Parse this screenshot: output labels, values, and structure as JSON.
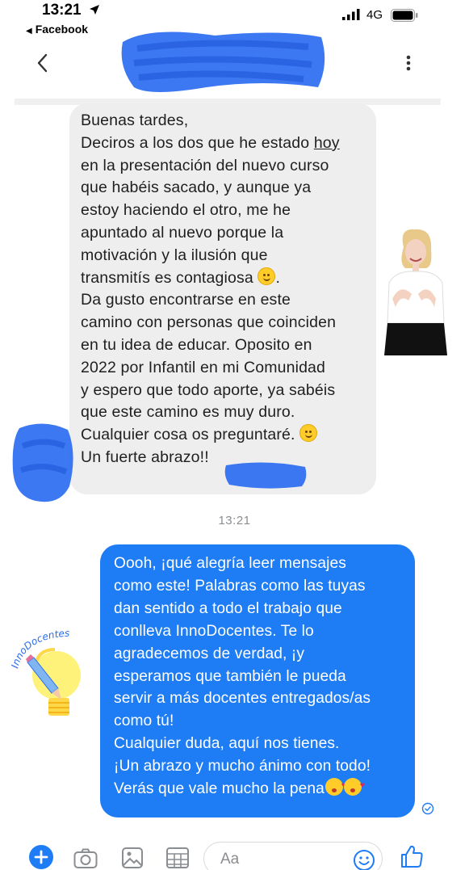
{
  "status_bar": {
    "time": "13:21",
    "back_app": "Facebook",
    "network": "4G"
  },
  "header": {
    "contact_name_redacted": true
  },
  "messages": {
    "received": {
      "lines_1": [
        "Buenas tardes,",
        "Deciros a los dos que he estado "
      ],
      "underlined_word": "hoy",
      "lines_2": "en la presentación del nuevo curso\nque habéis sacado, y aunque ya\nestoy haciendo el otro, me he\napuntado al nuevo porque la\nmotivación y la ilusión que",
      "line_contagiosa": "transmitís es contagiosa ",
      "dot": ".",
      "lines_3": "Da gusto encontrarse en este\ncamino con personas que coinciden\nen tu idea de educar. Oposito en\n2022  por Infantil en mi Comunidad\ny espero que todo aporte, ya sabéis\nque este camino es muy duro.",
      "line_pregunto": "Cualquier cosa os preguntaré. ",
      "line_abrazo": "Un fuerte abrazo!!"
    },
    "timestamp": "13:21",
    "sent": {
      "lines": [
        "Oooh, ¡qué alegría leer mensajes",
        "como este! Palabras como las tuyas",
        "dan sentido a todo el trabajo que",
        "conlleva InnoDocentes. Te lo",
        "agradecemos de verdad, ¡y",
        "esperamos que también le pueda",
        "servir a más docentes entregados/as",
        "como tú!",
        "Cualquier duda, aquí nos tienes.",
        "¡Un abrazo y mucho ánimo con todo!"
      ],
      "last_line": "Verás que vale mucho la pena"
    }
  },
  "logo": {
    "text": "InnoDocentes"
  },
  "composer": {
    "placeholder": "Aa"
  },
  "colors": {
    "sent_bubble": "#1e7cf4",
    "received_bubble": "#eeeeef",
    "accent": "#1e7cf4"
  },
  "icons": [
    "location-arrow-icon",
    "signal-icon",
    "battery-icon",
    "back-chevron-icon",
    "more-vertical-icon",
    "seen-check-icon",
    "plus-icon",
    "camera-icon",
    "photo-icon",
    "gif-icon",
    "emoji-icon",
    "thumbs-up-icon"
  ]
}
